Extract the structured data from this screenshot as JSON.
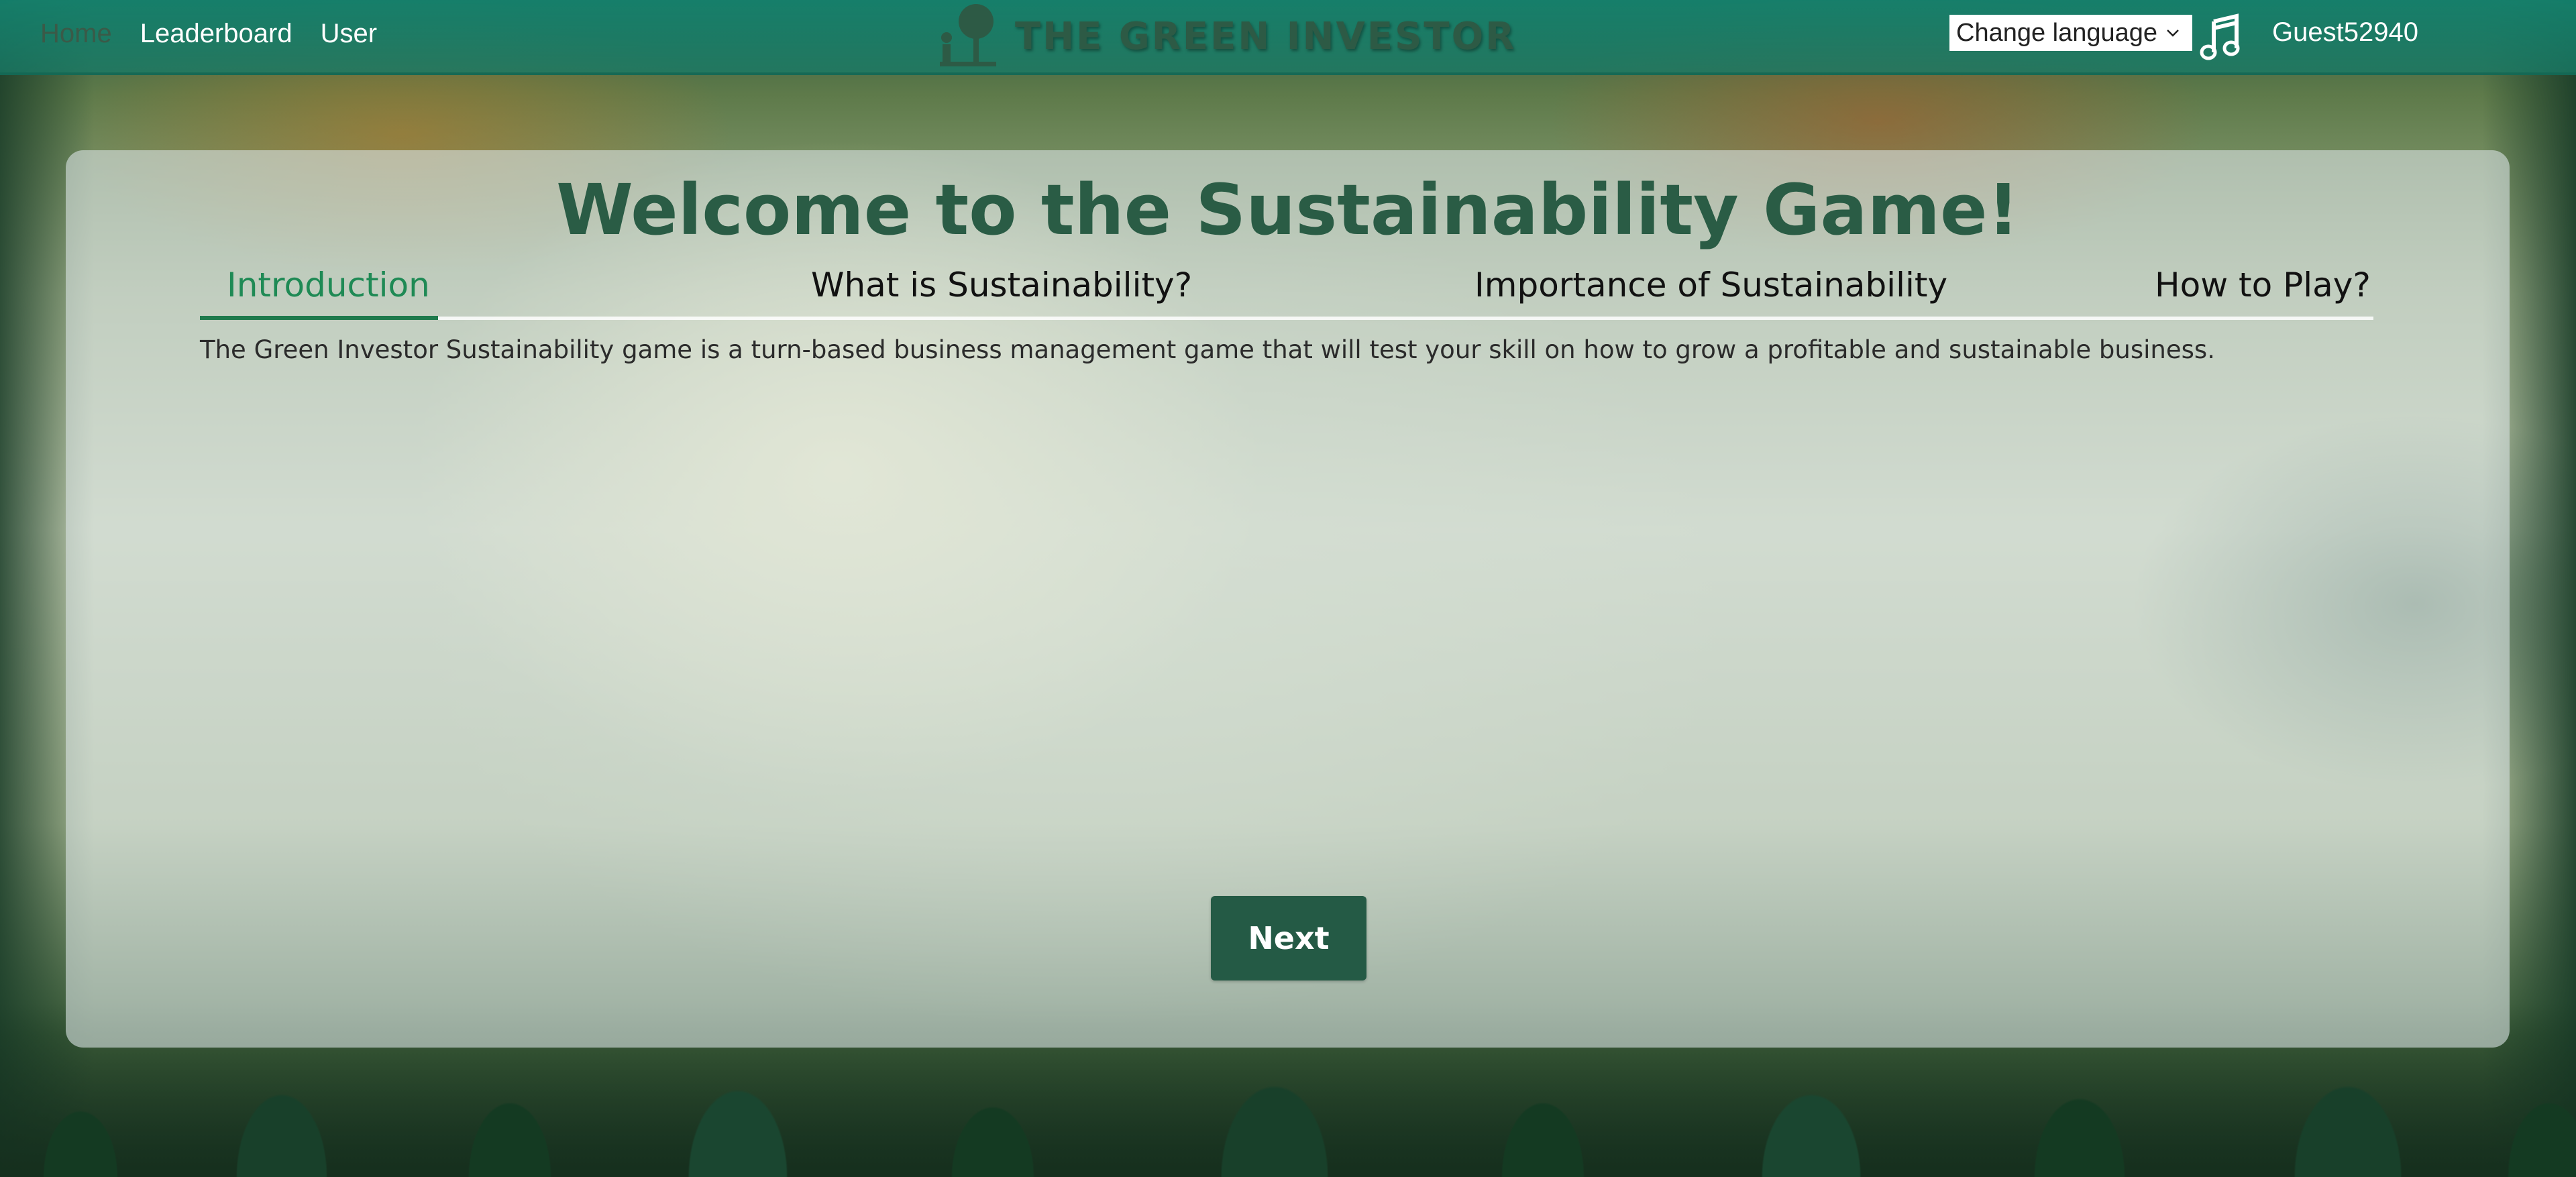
{
  "nav": {
    "links": [
      {
        "label": "Home",
        "active": true
      },
      {
        "label": "Leaderboard"
      },
      {
        "label": "User"
      }
    ],
    "brand_name": "THE GREEN INVESTOR",
    "language_select": "Change language",
    "music_icon": "music-note-icon",
    "username": "Guest52940"
  },
  "main": {
    "title": "Welcome to the Sustainability Game!",
    "tabs": [
      {
        "label": "Introduction",
        "active": true
      },
      {
        "label": "What is Sustainability?"
      },
      {
        "label": "Importance of Sustainability"
      },
      {
        "label": "How to Play?"
      }
    ],
    "intro_text": "The Green Investor Sustainability game is a turn-based business management game that will test your skill on how to grow a profitable and sustainable business.",
    "next_label": "Next"
  },
  "colors": {
    "navbar": "#17826e",
    "brand": "#2d5a45",
    "title": "#2a5c45",
    "active_tab": "#1f8a55",
    "button": "#245a45"
  }
}
